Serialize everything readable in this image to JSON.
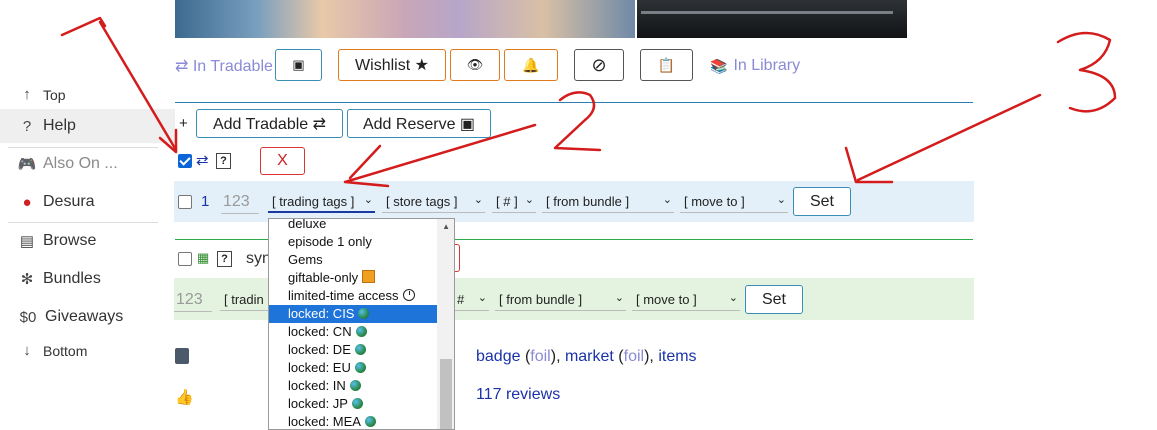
{
  "banners": {
    "left": "game-artwork",
    "right": "video-thumbnail"
  },
  "sidebar": {
    "top": {
      "icon": "up-arrow",
      "label": "Top"
    },
    "help": {
      "icon": "question",
      "label": "Help"
    },
    "also_on": {
      "icon": "gamepad",
      "label": "Also On ..."
    },
    "desura": {
      "icon": "desura",
      "label": "Desura"
    },
    "browse": {
      "icon": "browse",
      "label": "Browse"
    },
    "bundles": {
      "icon": "asterisk",
      "label": "Bundles"
    },
    "giveaways": {
      "icon_text": "$0",
      "label": "Giveaways"
    },
    "bottom": {
      "icon": "down-arrow",
      "label": "Bottom"
    }
  },
  "toolbar": {
    "in_tradable": "⇄ In Tradable",
    "tradable_square": "▣",
    "wishlist": "Wishlist ★",
    "eye": "👁",
    "bell": "🔔",
    "ignore": "⊘",
    "clipboard": "📋",
    "in_library": "In Library"
  },
  "actions": {
    "plus": "+",
    "add_tradable": "Add Tradable ⇄",
    "add_reserve": "Add Reserve ▣",
    "x": "X",
    "trade_icon": "⇄",
    "q": "?"
  },
  "row1": {
    "index": "1",
    "qty_placeholder": "123",
    "trading_tags": "[ trading tags ]",
    "store_tags": "[ store tags ]",
    "hash": "[ # ]",
    "from_bundle": "[ from bundle ]",
    "move_to": "[ move to ]",
    "set": "Set"
  },
  "row2": {
    "partial": "syn",
    "qty_placeholder": "123",
    "trading_tags": "[ tradin",
    "hash": "#",
    "from_bundle": "[ from bundle ]",
    "move_to": "[ move to ]",
    "set": "Set"
  },
  "dropdown": {
    "items": [
      {
        "label": "deluxe",
        "icon": ""
      },
      {
        "label": "episode 1 only",
        "icon": ""
      },
      {
        "label": "Gems",
        "icon": ""
      },
      {
        "label": "giftable-only",
        "icon": "gift"
      },
      {
        "label": "limited-time access",
        "icon": "clock"
      },
      {
        "label": "locked: CIS",
        "icon": "globe",
        "selected": true
      },
      {
        "label": "locked: CN",
        "icon": "globe"
      },
      {
        "label": "locked: DE",
        "icon": "globe"
      },
      {
        "label": "locked: EU",
        "icon": "globe"
      },
      {
        "label": "locked: IN",
        "icon": "globe"
      },
      {
        "label": "locked: JP",
        "icon": "globe"
      },
      {
        "label": "locked: MEA",
        "icon": "globe"
      }
    ]
  },
  "info": {
    "badge": "badge",
    "foil1": "foil",
    "market": "market",
    "foil2": "foil",
    "items": "items",
    "reviews": "117 reviews",
    "sep_open": " (",
    "sep_close": "), ",
    "sep_close2": "), "
  },
  "colors": {
    "accent_blue": "#2b7fb0",
    "orange": "#e07a1a",
    "link": "#1a33aa",
    "lavender": "#8a8ad6",
    "annotation_red": "#d41c1c"
  },
  "annotations": {
    "one": "1",
    "two": "2",
    "three": "3"
  }
}
